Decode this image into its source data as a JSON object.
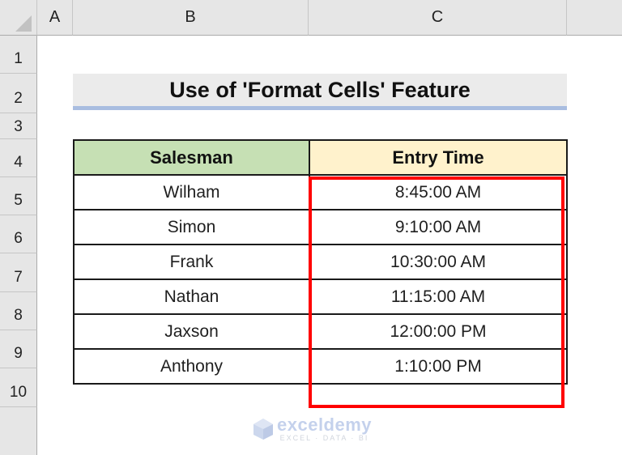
{
  "sheet": {
    "columns": [
      "A",
      "B",
      "C"
    ],
    "rows": [
      "1",
      "2",
      "3",
      "4",
      "5",
      "6",
      "7",
      "8",
      "9",
      "10"
    ]
  },
  "title": "Use of 'Format Cells' Feature",
  "table": {
    "headers": [
      "Salesman",
      "Entry Time"
    ],
    "rows": [
      [
        "Wilham",
        "8:45:00 AM"
      ],
      [
        "Simon",
        "9:10:00 AM"
      ],
      [
        "Frank",
        "10:30:00 AM"
      ],
      [
        "Nathan",
        "11:15:00 AM"
      ],
      [
        "Jaxson",
        "12:00:00 PM"
      ],
      [
        "Anthony",
        "1:10:00 PM"
      ]
    ]
  },
  "colors": {
    "salesman_header": "#c6e0b4",
    "entry_time_header": "#fff2cc",
    "highlight_border": "#ff0000",
    "title_underline": "#a9bde0"
  },
  "watermark": {
    "brand": "exceldemy",
    "tagline": "EXCEL · DATA · BI",
    "icon": "exceldemy-logo-icon"
  }
}
